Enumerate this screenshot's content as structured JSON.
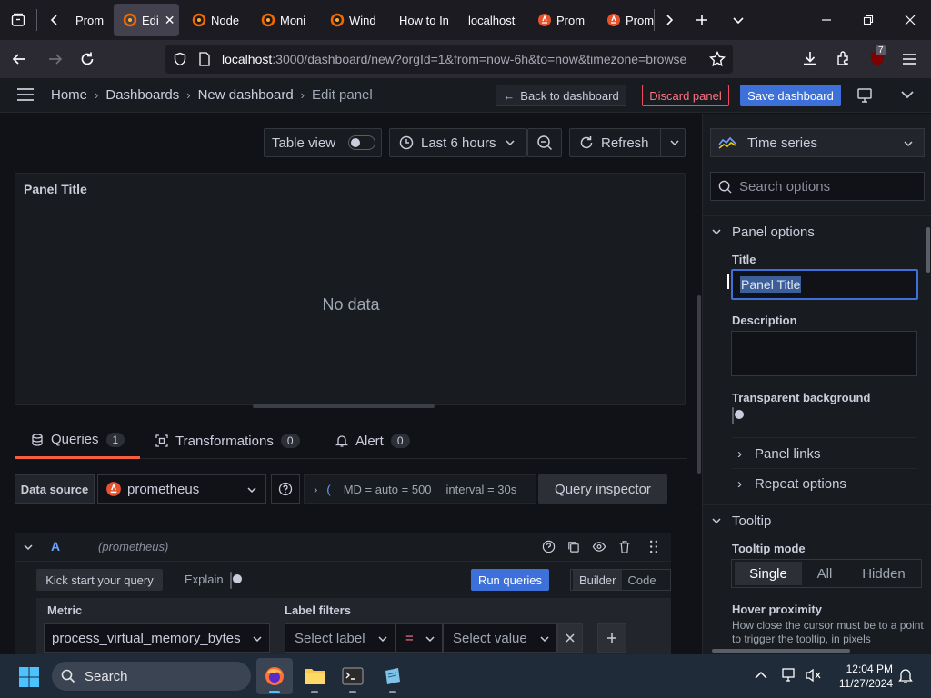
{
  "browser": {
    "tabs": [
      {
        "label": "Prom",
        "icon": "prometheus-icon"
      },
      {
        "label": "Edi",
        "icon": "grafana-icon",
        "active": true
      },
      {
        "label": "Node",
        "icon": "grafana-icon"
      },
      {
        "label": "Moni",
        "icon": "grafana-icon"
      },
      {
        "label": "Wind",
        "icon": "grafana-icon"
      },
      {
        "label": "How to In",
        "icon": "none"
      },
      {
        "label": "localhost",
        "icon": "none"
      },
      {
        "label": "Prom",
        "icon": "prometheus-icon"
      },
      {
        "label": "Prom",
        "icon": "prometheus-icon"
      }
    ],
    "url_host": "localhost",
    "url_rest": ":3000/dashboard/new?orgId=1&from=now-6h&to=now&timezone=browse",
    "extension_badge": "7"
  },
  "grafana": {
    "breadcrumb": [
      "Home",
      "Dashboards",
      "New dashboard",
      "Edit panel"
    ],
    "back_label": "Back to dashboard",
    "discard_label": "Discard panel",
    "save_label": "Save dashboard",
    "toolbar": {
      "table_view": "Table view",
      "time_range": "Last 6 hours",
      "refresh": "Refresh"
    },
    "panel": {
      "title": "Panel Title",
      "empty_text": "No data"
    },
    "tabs": [
      {
        "label": "Queries",
        "count": "1"
      },
      {
        "label": "Transformations",
        "count": "0"
      },
      {
        "label": "Alert",
        "count": "0"
      }
    ],
    "query": {
      "datasource_label": "Data source",
      "datasource": "prometheus",
      "options_summary_md": "MD = auto = 500",
      "options_summary_interval": "interval = 30s",
      "inspector": "Query inspector",
      "row_letter": "A",
      "row_ds": "(prometheus)",
      "kick_start": "Kick start your query",
      "explain": "Explain",
      "run": "Run queries",
      "builder": "Builder",
      "code": "Code",
      "metric_label": "Metric",
      "metric_value": "process_virtual_memory_bytes",
      "label_filters": "Label filters",
      "select_label": "Select label",
      "operator": "=",
      "select_value": "Select value"
    },
    "options": {
      "viz": "Time series",
      "search_placeholder": "Search options",
      "panel_options": "Panel options",
      "title_label": "Title",
      "title_value": "Panel Title",
      "description_label": "Description",
      "transparent_label": "Transparent background",
      "panel_links": "Panel links",
      "repeat_options": "Repeat options",
      "tooltip": "Tooltip",
      "tooltip_mode": "Tooltip mode",
      "modes": [
        "Single",
        "All",
        "Hidden"
      ],
      "hover_proximity": "Hover proximity",
      "hover_desc": "How close the cursor must be to a point to trigger the tooltip, in pixels"
    }
  },
  "taskbar": {
    "search": "Search",
    "time": "12:04 PM",
    "date": "11/27/2024"
  },
  "colors": {
    "accent": "#3d71d9",
    "discard": "#f2495c",
    "active_tab_underline": "#f55f3e"
  }
}
